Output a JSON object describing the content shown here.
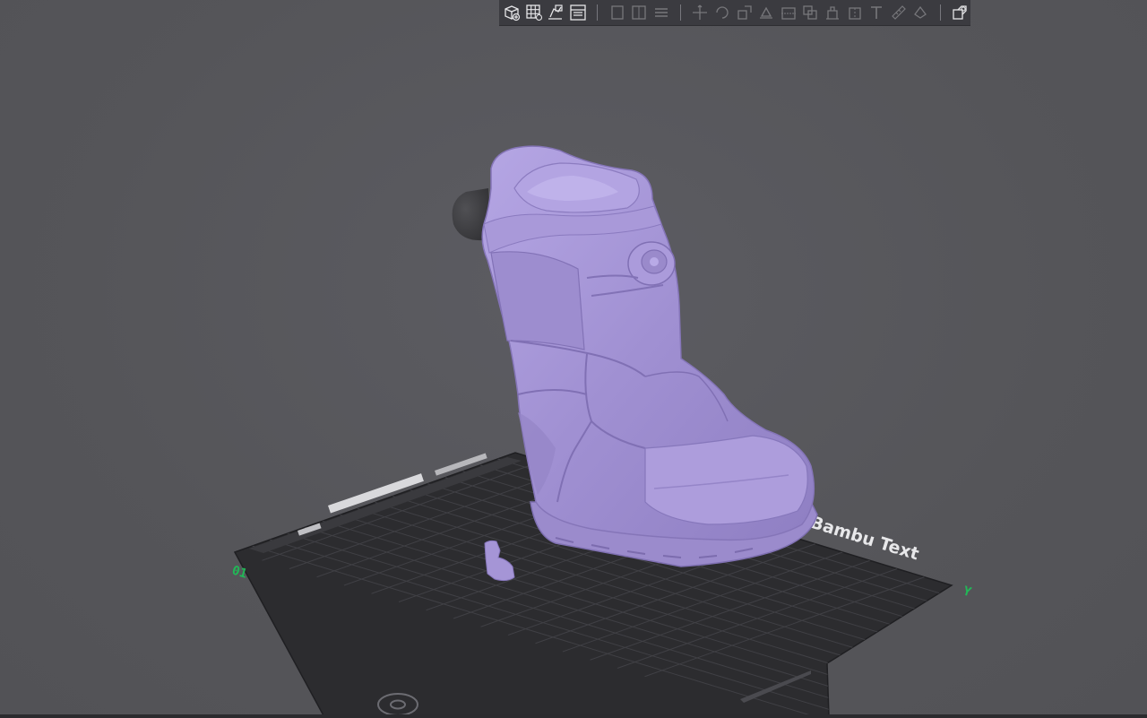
{
  "toolbar": {
    "tools": [
      {
        "name": "add-object",
        "icon": "cube-plus-icon",
        "enabled": true
      },
      {
        "name": "arrange",
        "icon": "grid-icon",
        "enabled": true
      },
      {
        "name": "orient",
        "icon": "orient-icon",
        "enabled": true
      },
      {
        "name": "plates",
        "icon": "plates-icon",
        "enabled": true
      },
      {
        "name": "split-objects",
        "icon": "split-icon",
        "enabled": false
      },
      {
        "name": "split-parts",
        "icon": "split-parts-icon",
        "enabled": false
      },
      {
        "name": "layers",
        "icon": "layers-icon",
        "enabled": false
      },
      {
        "name": "move",
        "icon": "move-icon",
        "enabled": false
      },
      {
        "name": "rotate",
        "icon": "rotate-icon",
        "enabled": false
      },
      {
        "name": "scale",
        "icon": "scale-icon",
        "enabled": false
      },
      {
        "name": "lay-on-face",
        "icon": "lay-on-face-icon",
        "enabled": false
      },
      {
        "name": "cut",
        "icon": "cut-icon",
        "enabled": false
      },
      {
        "name": "mesh-boolean",
        "icon": "boolean-icon",
        "enabled": false
      },
      {
        "name": "support-paint",
        "icon": "support-paint-icon",
        "enabled": false
      },
      {
        "name": "seam-paint",
        "icon": "seam-paint-icon",
        "enabled": false
      },
      {
        "name": "text-emboss",
        "icon": "text-icon",
        "enabled": false
      },
      {
        "name": "measure",
        "icon": "measure-icon",
        "enabled": false
      },
      {
        "name": "color-paint",
        "icon": "color-paint-icon",
        "enabled": false
      },
      {
        "name": "assembly-view",
        "icon": "assembly-icon",
        "enabled": true
      }
    ]
  },
  "plate": {
    "label": "Bambu Text",
    "index_label": "01",
    "x_axis_label": "Y",
    "name_field": "........."
  },
  "colors": {
    "background": "#57575d",
    "plate": "#2c2c2f",
    "grid": "#3d3d41",
    "model": "#a393d4",
    "toolbar": "#3b3b40",
    "axis_green": "#21b857"
  }
}
